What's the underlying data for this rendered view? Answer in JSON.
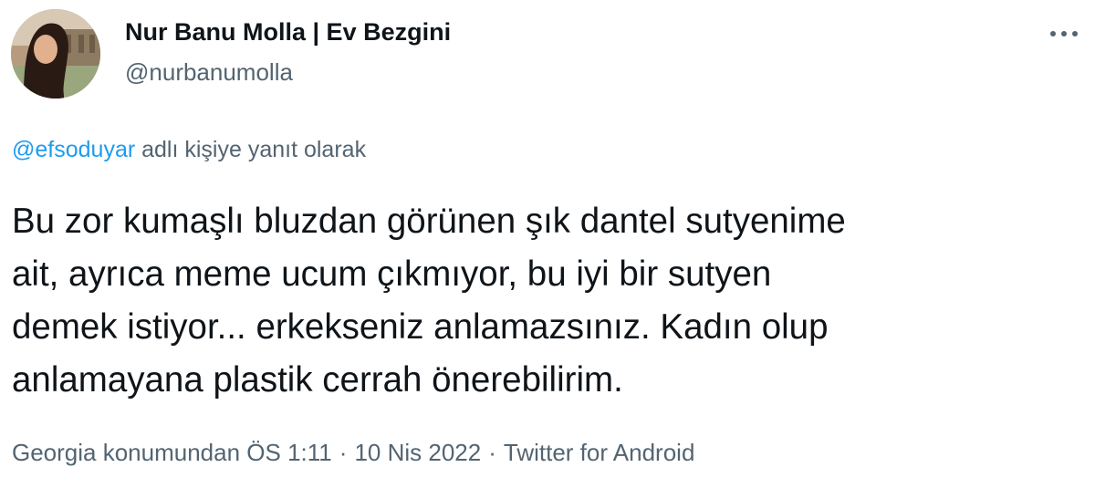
{
  "author": {
    "display_name": "Nur Banu Molla | Ev Bezgini",
    "handle": "@nurbanumolla"
  },
  "reply": {
    "mention": "@efsoduyar",
    "suffix": " adlı kişiye yanıt olarak"
  },
  "tweet": {
    "text": "Bu zor kumaşlı bluzdan görünen şık dantel sutyenime\nait, ayrıca meme ucum çıkmıyor, bu iyi bir sutyen\ndemek istiyor... erkekseniz anlamazsınız. Kadın olup\nanlamayana plastik cerrah önerebilirim."
  },
  "meta": {
    "location": "Georgia konumundan",
    "time": "ÖS 1:11",
    "separator": "·",
    "date": "10 Nis 2022",
    "source": "Twitter for Android"
  },
  "colors": {
    "link": "#1d9bf0",
    "secondary_text": "#536471",
    "primary_text": "#0f1419"
  },
  "icons": {
    "more": "more-options-icon",
    "avatar": "profile-photo"
  }
}
